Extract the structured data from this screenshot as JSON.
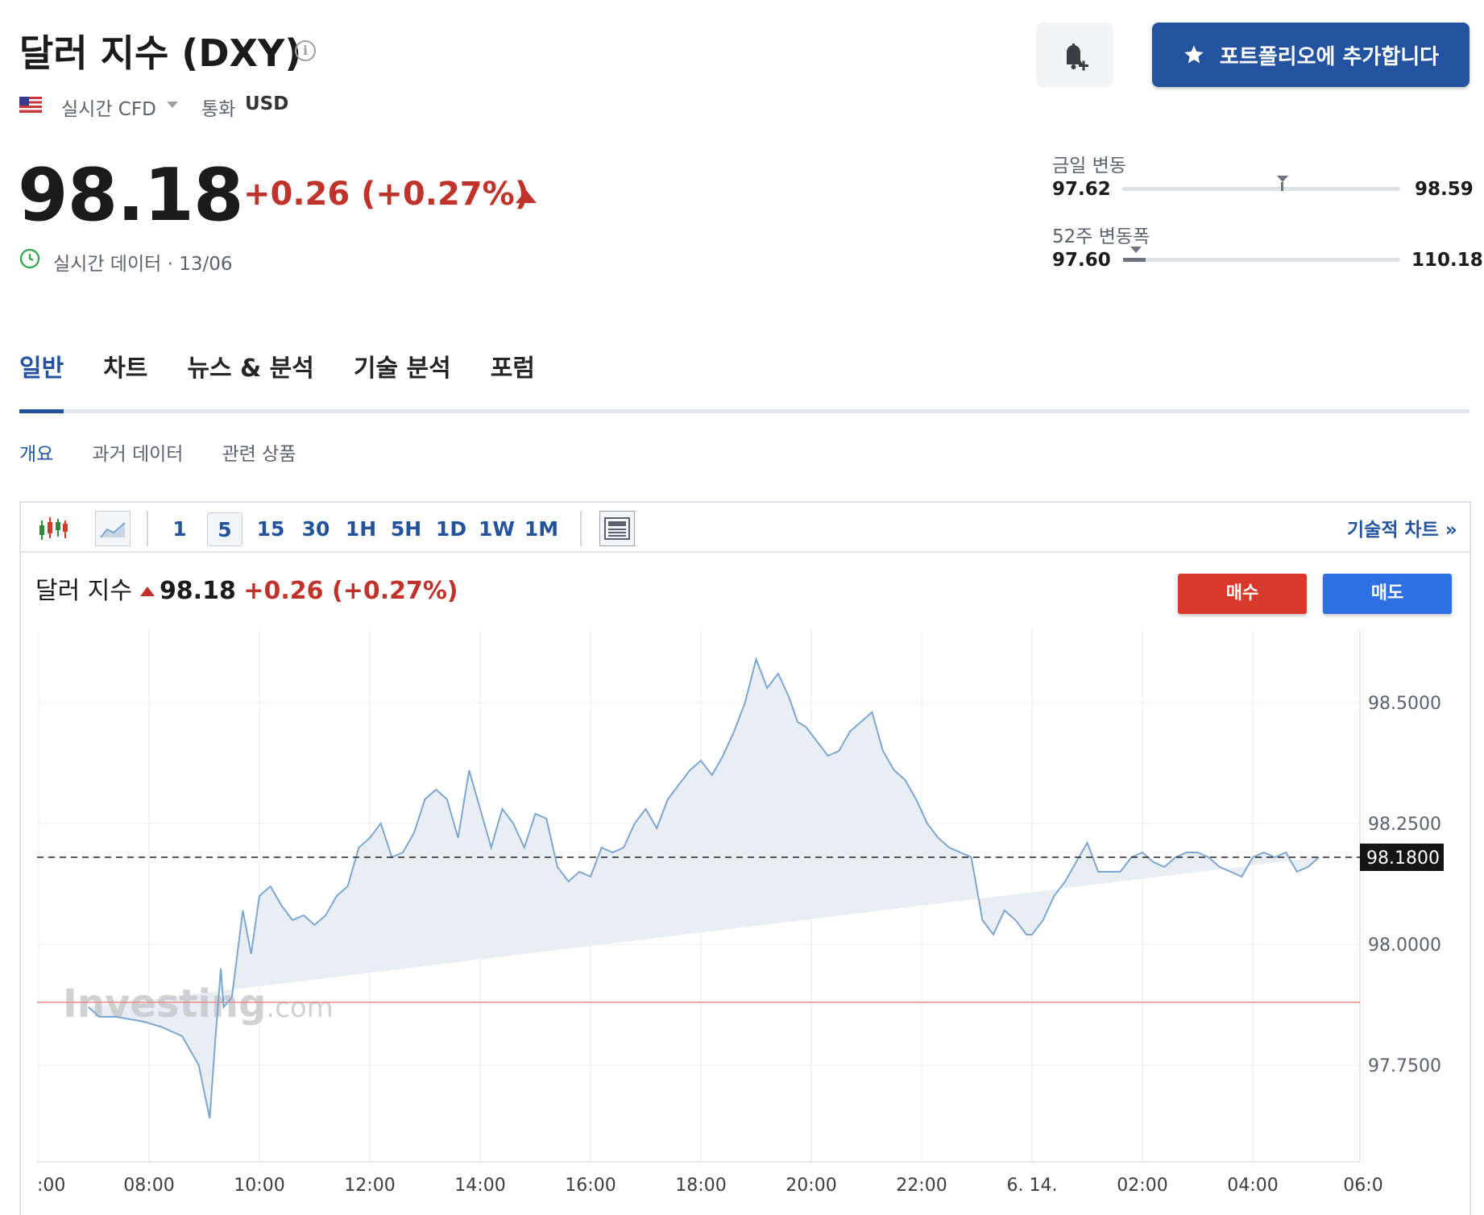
{
  "header": {
    "title": "달러 지수 (DXY)",
    "source": "실시간 CFD",
    "currency_label": "통화",
    "currency": "USD",
    "add_portfolio_label": "포트폴리오에 추가합니다"
  },
  "quote": {
    "price": "98.18",
    "change": "+0.26 (+0.27%)",
    "realtime_label": "실시간 데이터 · 13/06"
  },
  "ranges": {
    "daily": {
      "label": "금일 변동",
      "low": "97.62",
      "high": "98.59",
      "current": 98.18,
      "low_value": 97.62,
      "high_value": 98.59
    },
    "week52": {
      "label": "52주 변동폭",
      "low": "97.60",
      "high": "110.18",
      "current": 98.18,
      "low_value": 97.6,
      "high_value": 110.18
    }
  },
  "tabs": [
    {
      "label": "일반",
      "active": true
    },
    {
      "label": "차트",
      "active": false
    },
    {
      "label": "뉴스 & 분석",
      "active": false
    },
    {
      "label": "기술 분석",
      "active": false
    },
    {
      "label": "포럼",
      "active": false
    }
  ],
  "subtabs": [
    {
      "label": "개요",
      "active": true
    },
    {
      "label": "과거 데이터",
      "active": false
    },
    {
      "label": "관련 상품",
      "active": false
    }
  ],
  "toolbar": {
    "intervals": [
      {
        "label": "1",
        "active": false
      },
      {
        "label": "5",
        "active": true
      },
      {
        "label": "15",
        "active": false
      },
      {
        "label": "30",
        "active": false
      },
      {
        "label": "1H",
        "active": false
      },
      {
        "label": "5H",
        "active": false
      },
      {
        "label": "1D",
        "active": false
      },
      {
        "label": "1W",
        "active": false
      },
      {
        "label": "1M",
        "active": false
      }
    ],
    "technical_chart_label": "기술적 차트 »"
  },
  "chart_header": {
    "name": "달러 지수",
    "price": "98.18",
    "change": "+0.26 (+0.27%)",
    "buy_label": "매수",
    "sell_label": "매도"
  },
  "watermark": "Investing.com",
  "colors": {
    "brand": "#23539e",
    "negative_red": "#c0332b",
    "buy": "#d9392a",
    "sell": "#2e6fe4",
    "line": "#7ea6cf",
    "area": "#e9eef5"
  },
  "chart_data": {
    "type": "area",
    "x_tick_labels": [
      ":00",
      "08:00",
      "10:00",
      "12:00",
      "14:00",
      "16:00",
      "18:00",
      "20:00",
      "22:00",
      "6. 14.",
      "02:00",
      "04:00",
      "06:0"
    ],
    "y_tick_labels": [
      "98.5000",
      "98.2500",
      "98.0000",
      "97.7500"
    ],
    "y_ticks": [
      98.5,
      98.25,
      98.0,
      97.75
    ],
    "ylim": [
      97.55,
      98.65
    ],
    "current_price": 98.18,
    "current_price_label": "98.1800",
    "reference_price": 97.88,
    "x_hours": [
      6.9,
      7.1,
      7.4,
      7.9,
      8.2,
      8.6,
      8.9,
      9.1,
      9.2,
      9.3,
      9.35,
      9.5,
      9.7,
      9.85,
      10.0,
      10.2,
      10.4,
      10.6,
      10.8,
      11.0,
      11.2,
      11.4,
      11.6,
      11.8,
      12.0,
      12.2,
      12.4,
      12.6,
      12.8,
      13.0,
      13.2,
      13.4,
      13.6,
      13.8,
      14.0,
      14.2,
      14.4,
      14.6,
      14.8,
      15.0,
      15.2,
      15.4,
      15.6,
      15.8,
      16.0,
      16.2,
      16.4,
      16.6,
      16.8,
      17.0,
      17.2,
      17.4,
      17.6,
      17.8,
      18.0,
      18.2,
      18.4,
      18.6,
      18.8,
      19.0,
      19.2,
      19.4,
      19.6,
      19.75,
      19.9,
      20.1,
      20.3,
      20.5,
      20.7,
      20.9,
      21.1,
      21.3,
      21.5,
      21.7,
      21.9,
      22.1,
      22.3,
      22.5,
      22.7,
      22.9,
      23.1,
      23.3,
      23.5,
      23.7,
      23.9,
      24.0,
      24.2,
      24.4,
      24.6,
      24.8,
      25.0,
      25.2,
      25.4,
      25.6,
      25.8,
      26.0,
      26.2,
      26.4,
      26.6,
      26.8,
      27.0,
      27.2,
      27.4,
      27.6,
      27.8,
      28.0,
      28.2,
      28.4,
      28.6,
      28.8,
      29.0,
      29.2,
      29.4,
      29.6,
      29.8,
      30.0,
      30.2
    ],
    "values": [
      97.87,
      97.85,
      97.85,
      97.84,
      97.83,
      97.81,
      97.75,
      97.64,
      97.8,
      97.95,
      97.87,
      97.89,
      98.07,
      97.98,
      98.1,
      98.12,
      98.08,
      98.05,
      98.06,
      98.04,
      98.06,
      98.1,
      98.12,
      98.2,
      98.22,
      98.25,
      98.18,
      98.19,
      98.23,
      98.3,
      98.32,
      98.3,
      98.22,
      98.36,
      98.28,
      98.2,
      98.28,
      98.25,
      98.2,
      98.27,
      98.26,
      98.16,
      98.13,
      98.15,
      98.14,
      98.2,
      98.19,
      98.2,
      98.25,
      98.28,
      98.24,
      98.3,
      98.33,
      98.36,
      98.38,
      98.35,
      98.39,
      98.44,
      98.5,
      98.59,
      98.53,
      98.56,
      98.51,
      98.46,
      98.45,
      98.42,
      98.39,
      98.4,
      98.44,
      98.46,
      98.48,
      98.4,
      98.36,
      98.34,
      98.3,
      98.25,
      98.22,
      98.2,
      98.19,
      98.18,
      98.05,
      98.02,
      98.07,
      98.05,
      98.02,
      98.02,
      98.05,
      98.1,
      98.13,
      98.17,
      98.21,
      98.15,
      98.15,
      98.15,
      98.18,
      98.19,
      98.17,
      98.16,
      98.18,
      98.19,
      98.19,
      98.18,
      98.16,
      98.15,
      98.14,
      98.18,
      98.19,
      98.18,
      98.19,
      98.15,
      98.16,
      98.18
    ]
  }
}
